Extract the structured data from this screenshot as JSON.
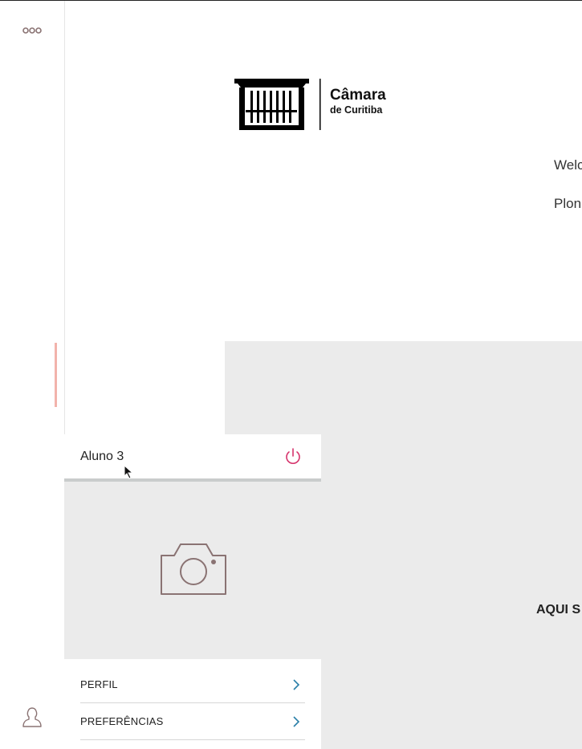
{
  "header": {
    "more_icon": "more-dots-icon",
    "logo": {
      "name": "Câmara",
      "subtitle": "de Curitiba"
    },
    "welcome_text": "Welc",
    "plone_text": "Plon"
  },
  "sidebar": {
    "user_icon": "user-icon"
  },
  "user_panel": {
    "username": "Aluno 3",
    "logout_icon": "power-icon",
    "photo_icon": "camera-icon",
    "menu": [
      {
        "label": "PERFIL",
        "icon": "chevron-right-icon"
      },
      {
        "label": "PREFERÊNCIAS",
        "icon": "chevron-right-icon"
      }
    ]
  },
  "main": {
    "placeholder_text": "AQUI S"
  },
  "colors": {
    "accent": "#d6336c",
    "link_chevron": "#2a7fa8",
    "icon_muted": "#8a7373",
    "panel_bg": "#ebebeb",
    "sidebar_mark": "#f2b3ab"
  }
}
